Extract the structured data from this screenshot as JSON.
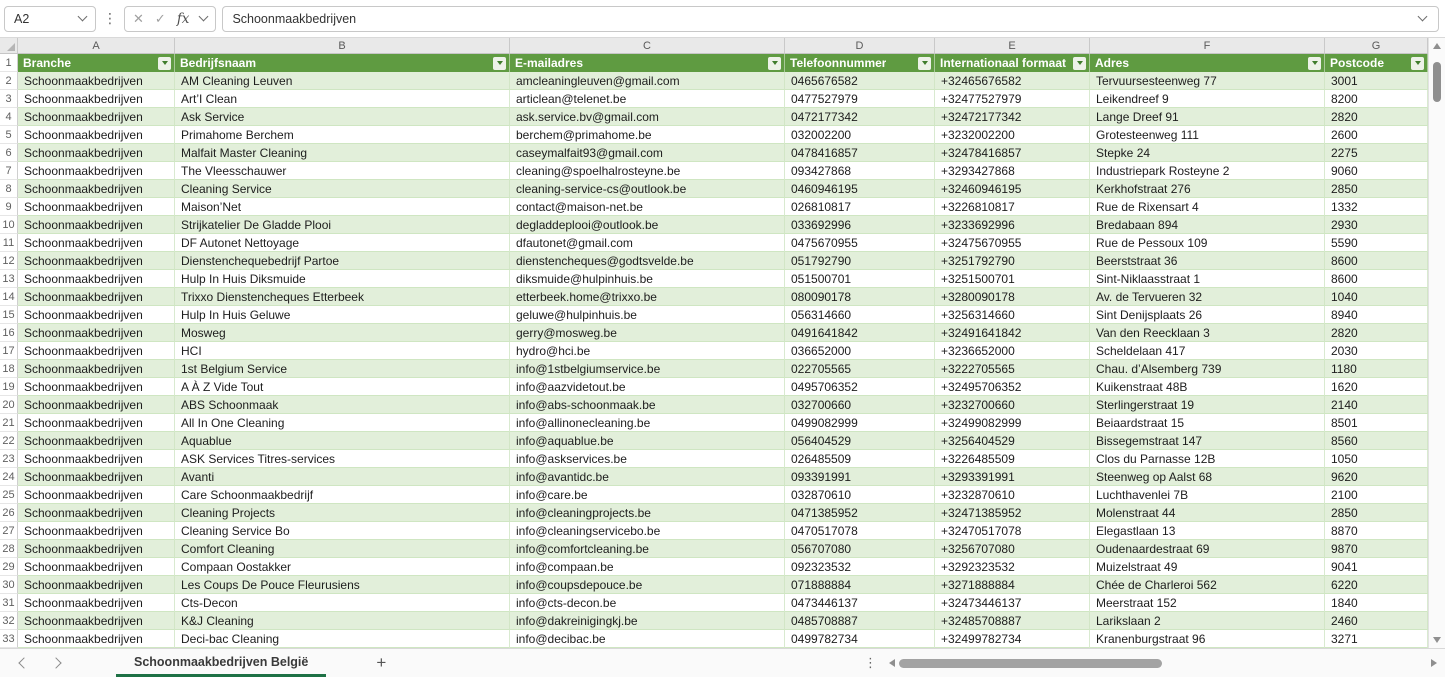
{
  "formula_bar": {
    "cell_reference": "A2",
    "formula_value": "Schoonmaakbedrijven"
  },
  "icons": {
    "cancel": "✕",
    "confirm": "✓",
    "fx": "fx",
    "kebab": "⋮",
    "plus": "+"
  },
  "columns": {
    "letters": [
      "A",
      "B",
      "C",
      "D",
      "E",
      "F",
      "G"
    ],
    "headers": [
      "Branche",
      "Bedrijfsnaam",
      "E-mailadres",
      "Telefoonnummer",
      "Internationaal formaat",
      "Adres",
      "Postcode"
    ],
    "header_row_number": "1"
  },
  "rows": [
    {
      "n": "2",
      "cells": [
        "Schoonmaakbedrijven",
        "AM Cleaning Leuven",
        "amcleaningleuven@gmail.com",
        "0465676582",
        "+32465676582",
        "Tervuursesteenweg 77",
        "3001"
      ]
    },
    {
      "n": "3",
      "cells": [
        "Schoonmaakbedrijven",
        "Art’I Clean",
        "articlean@telenet.be",
        "0477527979",
        "+32477527979",
        "Leikendreef 9",
        "8200"
      ]
    },
    {
      "n": "4",
      "cells": [
        "Schoonmaakbedrijven",
        "Ask Service",
        "ask.service.bv@gmail.com",
        "0472177342",
        "+32472177342",
        "Lange Dreef 91",
        "2820"
      ]
    },
    {
      "n": "5",
      "cells": [
        "Schoonmaakbedrijven",
        "Primahome Berchem",
        "berchem@primahome.be",
        "032002200",
        "+3232002200",
        "Grotesteenweg 111",
        "2600"
      ]
    },
    {
      "n": "6",
      "cells": [
        "Schoonmaakbedrijven",
        "Malfait Master Cleaning",
        "caseymalfait93@gmail.com",
        "0478416857",
        "+32478416857",
        "Stepke 24",
        "2275"
      ]
    },
    {
      "n": "7",
      "cells": [
        "Schoonmaakbedrijven",
        "The Vleesschauwer",
        "cleaning@spoelhalrosteyne.be",
        "093427868",
        "+3293427868",
        "Industriepark Rosteyne 2",
        "9060"
      ]
    },
    {
      "n": "8",
      "cells": [
        "Schoonmaakbedrijven",
        "Cleaning Service",
        "cleaning-service-cs@outlook.be",
        "0460946195",
        "+32460946195",
        "Kerkhofstraat 276",
        "2850"
      ]
    },
    {
      "n": "9",
      "cells": [
        "Schoonmaakbedrijven",
        "Maison’Net",
        "contact@maison-net.be",
        "026810817",
        "+3226810817",
        "Rue de Rixensart 4",
        "1332"
      ]
    },
    {
      "n": "10",
      "cells": [
        "Schoonmaakbedrijven",
        "Strijkatelier De Gladde Plooi",
        "degladdeplooi@outlook.be",
        "033692996",
        "+3233692996",
        "Bredabaan 894",
        "2930"
      ]
    },
    {
      "n": "11",
      "cells": [
        "Schoonmaakbedrijven",
        "DF Autonet Nettoyage",
        "dfautonet@gmail.com",
        "0475670955",
        "+32475670955",
        "Rue de Pessoux 109",
        "5590"
      ]
    },
    {
      "n": "12",
      "cells": [
        "Schoonmaakbedrijven",
        "Dienstenchequebedrijf Partoe",
        "dienstencheques@godtsvelde.be",
        "051792790",
        "+3251792790",
        "Beerststraat 36",
        "8600"
      ]
    },
    {
      "n": "13",
      "cells": [
        "Schoonmaakbedrijven",
        "Hulp In Huis Diksmuide",
        "diksmuide@hulpinhuis.be",
        "051500701",
        "+3251500701",
        "Sint-Niklaasstraat 1",
        "8600"
      ]
    },
    {
      "n": "14",
      "cells": [
        "Schoonmaakbedrijven",
        "Trixxo Dienstencheques Etterbeek",
        "etterbeek.home@trixxo.be",
        "080090178",
        "+3280090178",
        "Av. de Tervueren 32",
        "1040"
      ]
    },
    {
      "n": "15",
      "cells": [
        "Schoonmaakbedrijven",
        "Hulp In Huis Geluwe",
        "geluwe@hulpinhuis.be",
        "056314660",
        "+3256314660",
        "Sint Denijsplaats 26",
        "8940"
      ]
    },
    {
      "n": "16",
      "cells": [
        "Schoonmaakbedrijven",
        "Mosweg",
        "gerry@mosweg.be",
        "0491641842",
        "+32491641842",
        "Van den Reecklaan 3",
        "2820"
      ]
    },
    {
      "n": "17",
      "cells": [
        "Schoonmaakbedrijven",
        "HCI",
        "hydro@hci.be",
        "036652000",
        "+3236652000",
        "Scheldelaan 417",
        "2030"
      ]
    },
    {
      "n": "18",
      "cells": [
        "Schoonmaakbedrijven",
        "1st Belgium Service",
        "info@1stbelgiumservice.be",
        "022705565",
        "+3222705565",
        "Chau. d’Alsemberg 739",
        "1180"
      ]
    },
    {
      "n": "19",
      "cells": [
        "Schoonmaakbedrijven",
        "A À Z Vide Tout",
        "info@aazvidetout.be",
        "0495706352",
        "+32495706352",
        "Kuikenstraat 48B",
        "1620"
      ]
    },
    {
      "n": "20",
      "cells": [
        "Schoonmaakbedrijven",
        "ABS Schoonmaak",
        "info@abs-schoonmaak.be",
        "032700660",
        "+3232700660",
        "Sterlingerstraat 19",
        "2140"
      ]
    },
    {
      "n": "21",
      "cells": [
        "Schoonmaakbedrijven",
        "All In One Cleaning",
        "info@allinonecleaning.be",
        "0499082999",
        "+32499082999",
        "Beiaardstraat 15",
        "8501"
      ]
    },
    {
      "n": "22",
      "cells": [
        "Schoonmaakbedrijven",
        "Aquablue",
        "info@aquablue.be",
        "056404529",
        "+3256404529",
        "Bissegemstraat 147",
        "8560"
      ]
    },
    {
      "n": "23",
      "cells": [
        "Schoonmaakbedrijven",
        "ASK Services Titres-services",
        "info@askservices.be",
        "026485509",
        "+3226485509",
        "Clos du Parnasse 12B",
        "1050"
      ]
    },
    {
      "n": "24",
      "cells": [
        "Schoonmaakbedrijven",
        "Avanti",
        "info@avantidc.be",
        "093391991",
        "+3293391991",
        "Steenweg op Aalst 68",
        "9620"
      ]
    },
    {
      "n": "25",
      "cells": [
        "Schoonmaakbedrijven",
        "Care Schoonmaakbedrijf",
        "info@care.be",
        "032870610",
        "+3232870610",
        "Luchthavenlei 7B",
        "2100"
      ]
    },
    {
      "n": "26",
      "cells": [
        "Schoonmaakbedrijven",
        "Cleaning Projects",
        "info@cleaningprojects.be",
        "0471385952",
        "+32471385952",
        "Molenstraat 44",
        "2850"
      ]
    },
    {
      "n": "27",
      "cells": [
        "Schoonmaakbedrijven",
        "Cleaning Service Bo",
        "info@cleaningservicebo.be",
        "0470517078",
        "+32470517078",
        "Elegastlaan 13",
        "8870"
      ]
    },
    {
      "n": "28",
      "cells": [
        "Schoonmaakbedrijven",
        "Comfort Cleaning",
        "info@comfortcleaning.be",
        "056707080",
        "+3256707080",
        "Oudenaardestraat 69",
        "9870"
      ]
    },
    {
      "n": "29",
      "cells": [
        "Schoonmaakbedrijven",
        "Compaan Oostakker",
        "info@compaan.be",
        "092323532",
        "+3292323532",
        "Muizelstraat 49",
        "9041"
      ]
    },
    {
      "n": "30",
      "cells": [
        "Schoonmaakbedrijven",
        "Les Coups De Pouce Fleurusiens",
        "info@coupsdepouce.be",
        "071888884",
        "+3271888884",
        "Chée de Charleroi 562",
        "6220"
      ]
    },
    {
      "n": "31",
      "cells": [
        "Schoonmaakbedrijven",
        "Cts-Decon",
        "info@cts-decon.be",
        "0473446137",
        "+32473446137",
        "Meerstraat 152",
        "1840"
      ]
    },
    {
      "n": "32",
      "cells": [
        "Schoonmaakbedrijven",
        "K&J Cleaning",
        "info@dakreinigingkj.be",
        "0485708887",
        "+32485708887",
        "Larikslaan 2",
        "2460"
      ]
    },
    {
      "n": "33",
      "cells": [
        "Schoonmaakbedrijven",
        "Deci-bac Cleaning",
        "info@decibac.be",
        "0499782734",
        "+32499782734",
        "Kranenburgstraat 96",
        "3271"
      ]
    }
  ],
  "sheet_bar": {
    "active_tab": "Schoonmaakbedrijven België"
  },
  "colors": {
    "table_header_green": "#5f9b41",
    "band_light_green": "#e2efda",
    "tab_underline_green": "#1e7145",
    "filter_arrow_green": "#3f7d2c"
  }
}
